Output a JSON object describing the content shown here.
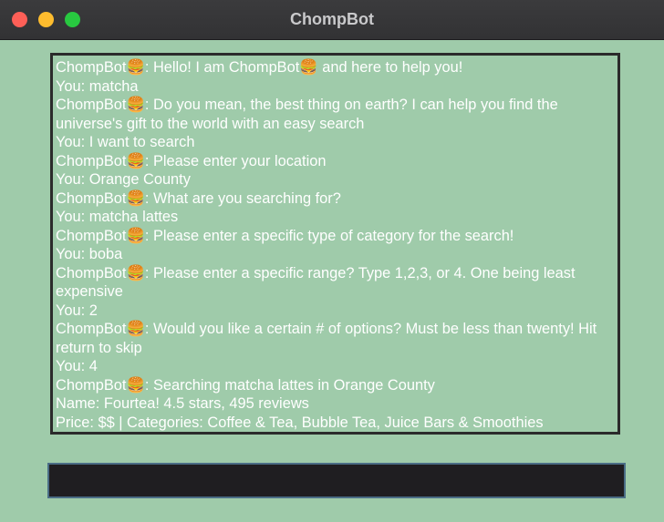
{
  "window": {
    "title": "ChompBot"
  },
  "chat": {
    "messages": [
      "ChompBot🍔: Hello! I am ChompBot🍔 and here to help you!",
      "You: matcha",
      "ChompBot🍔: Do you mean, the best thing on earth? I can help you find the universe's gift to the world with an easy search",
      "You: I want to search",
      "ChompBot🍔: Please enter your location",
      "You: Orange County",
      "ChompBot🍔: What are you searching for?",
      "You: matcha lattes",
      "ChompBot🍔: Please enter a specific type of category for the search!",
      "You: boba",
      "ChompBot🍔: Please enter a specific range? Type 1,2,3, or 4. One being least expensive",
      "You: 2",
      "ChompBot🍔: Would you like a certain # of options? Must be less than twenty! Hit return to skip",
      "You: 4",
      "ChompBot🍔: Searching matcha lattes in Orange County",
      "Name: Fourtea! 4.5 stars, 495 reviews",
      "Price: $$ | Categories: Coffee & Tea, Bubble Tea, Juice Bars & Smoothies"
    ]
  },
  "input": {
    "value": ""
  }
}
